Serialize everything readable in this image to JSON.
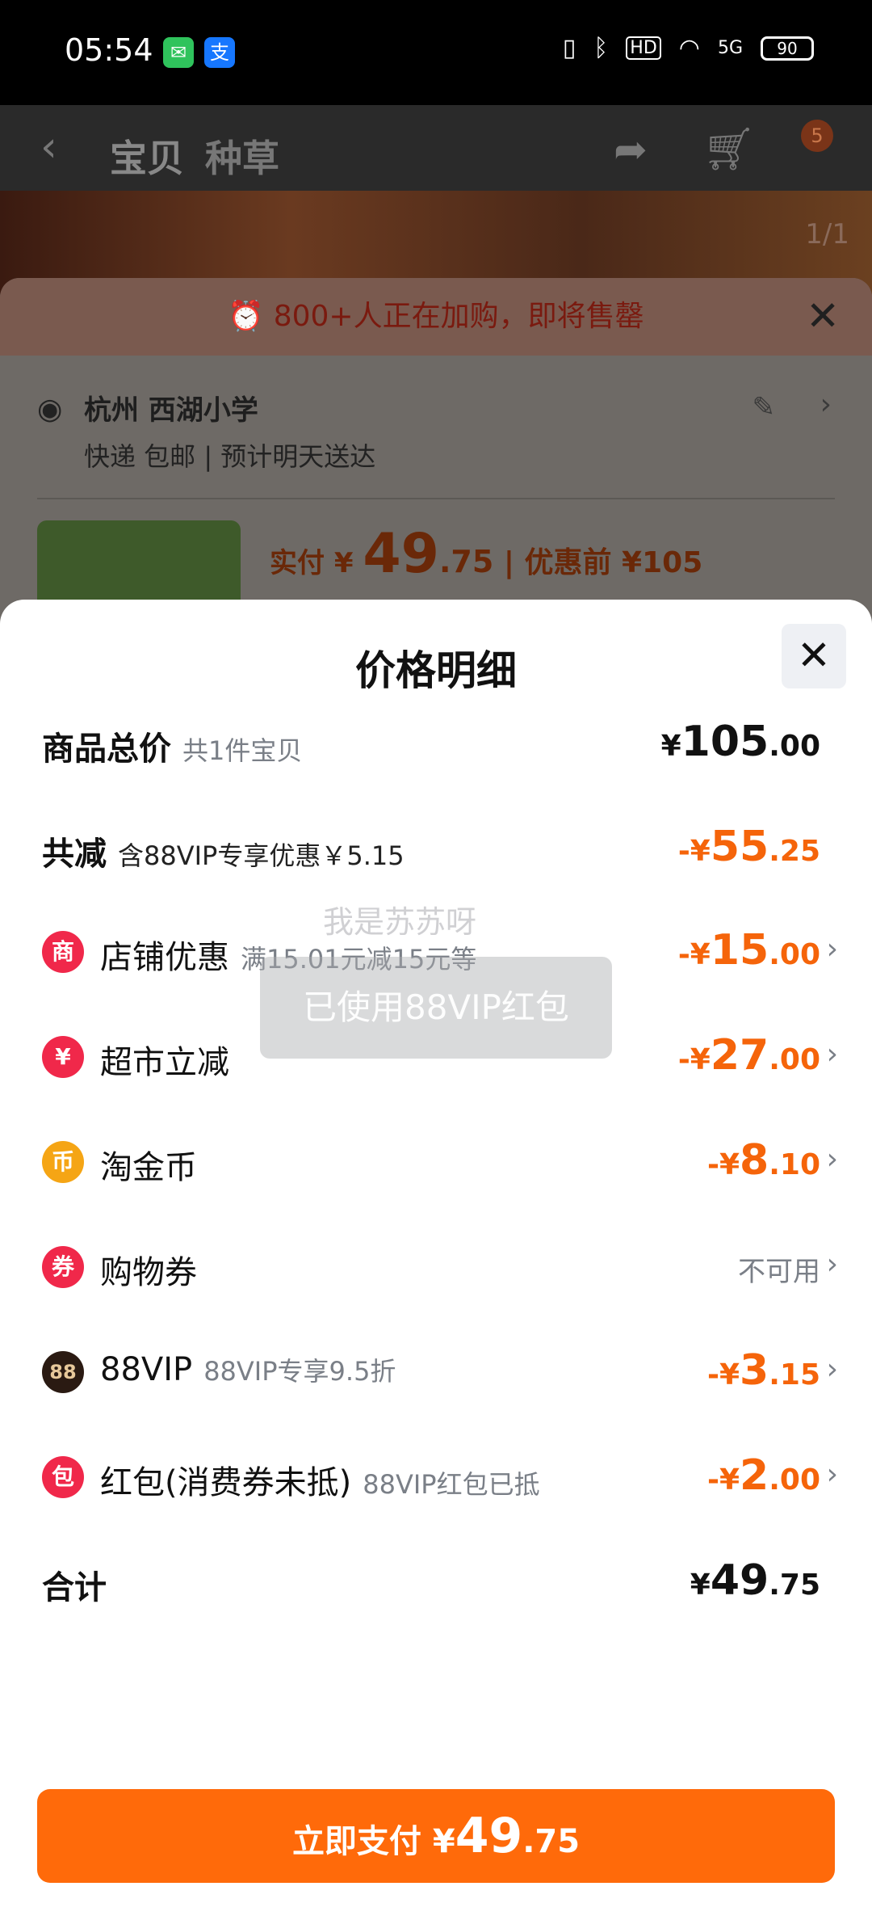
{
  "status_bar": {
    "time": "05:54",
    "battery": "90",
    "network": "5G"
  },
  "nav": {
    "tab_product": "宝贝",
    "tab_grass": "种草",
    "cart_badge": "5",
    "image_counter": "1/1"
  },
  "alert": {
    "text": "800+人正在加购，即将售罄"
  },
  "address": {
    "title": "杭州 西湖小学",
    "subtitle": "快递 包邮 | 预计明天送达"
  },
  "price_bar": {
    "label": "实付 ¥ ",
    "int": "49",
    "dec": ".75",
    "pre": " | 优惠前 ¥105"
  },
  "sheet": {
    "title": "价格明细",
    "rows": [
      {
        "label": "商品总价",
        "note": "共1件宝贝",
        "currency": "¥",
        "int": "105",
        "dec": ".00"
      },
      {
        "label": "共减",
        "note": "含88VIP专享优惠￥5.15",
        "currency": "-¥",
        "int": "55",
        "dec": ".25"
      },
      {
        "label": "店铺优惠",
        "note": "满15.01元减15元等",
        "currency": "-¥",
        "int": "15",
        "dec": ".00"
      },
      {
        "label": "超市立减",
        "note": "",
        "currency": "-¥",
        "int": "27",
        "dec": ".00"
      },
      {
        "label": "淘金币",
        "note": "",
        "currency": "-¥",
        "int": "8",
        "dec": ".10"
      },
      {
        "label": "购物券",
        "note": "",
        "value_text": "不可用"
      },
      {
        "label": "88VIP",
        "note": "88VIP专享9.5折",
        "currency": "-¥",
        "int": "3",
        "dec": ".15"
      },
      {
        "label": "红包(消费券未抵)",
        "note": "88VIP红包已抵",
        "currency": "-¥",
        "int": "2",
        "dec": ".00"
      },
      {
        "label": "合计",
        "note": "",
        "currency": "¥",
        "int": "49",
        "dec": ".75"
      }
    ],
    "icons": {
      "shop": "商",
      "market": "¥",
      "coin": "币",
      "coupon": "券",
      "vip": "88",
      "redpacket": "包"
    }
  },
  "toast": {
    "text": "已使用88VIP红包"
  },
  "watermark": {
    "text": "我是苏苏呀"
  },
  "pay_button": {
    "label": "立即支付 ¥",
    "int": "49",
    "dec": ".75"
  },
  "colors": {
    "accent": "#ff6a0a",
    "discount": "#f5640a"
  }
}
